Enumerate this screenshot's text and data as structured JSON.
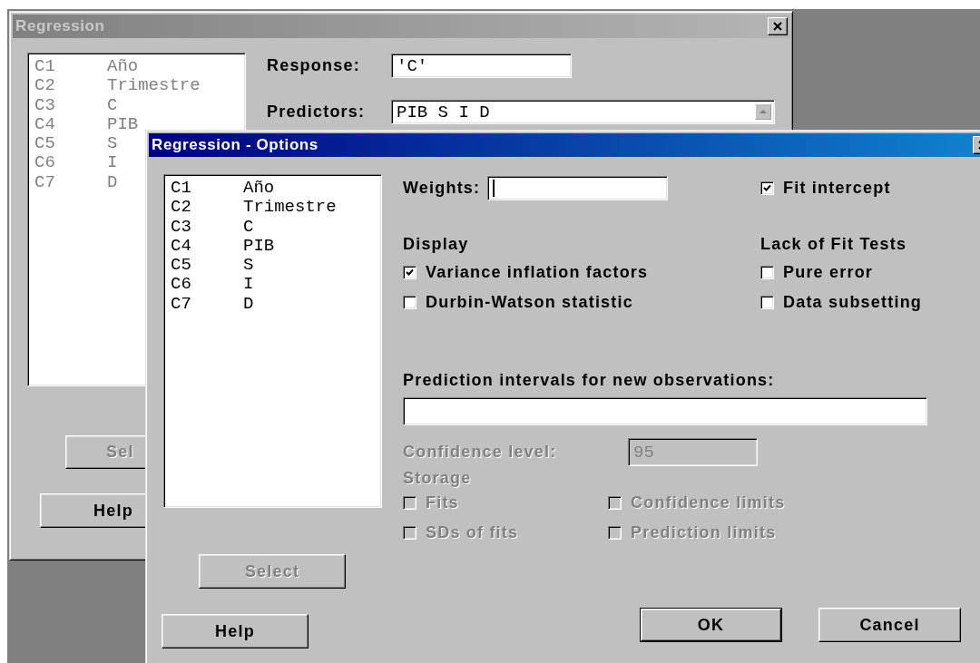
{
  "back_window": {
    "title": "Regression",
    "active": false,
    "columns": [
      {
        "id": "C1",
        "name": "Año"
      },
      {
        "id": "C2",
        "name": "Trimestre"
      },
      {
        "id": "C3",
        "name": "C"
      },
      {
        "id": "C4",
        "name": "PIB"
      },
      {
        "id": "C5",
        "name": "S"
      },
      {
        "id": "C6",
        "name": "I"
      },
      {
        "id": "C7",
        "name": "D"
      }
    ],
    "columns_disabled": true,
    "response": {
      "label": "Response:",
      "value": "'C'"
    },
    "predictors": {
      "label": "Predictors:",
      "value": "PIB S I D"
    },
    "buttons": [
      {
        "label": "Sel",
        "disabled": true
      },
      {
        "label": "Help",
        "disabled": false
      }
    ]
  },
  "options_window": {
    "title": "Regression - Options",
    "active": true,
    "columns": [
      {
        "id": "C1",
        "name": "Año"
      },
      {
        "id": "C2",
        "name": "Trimestre"
      },
      {
        "id": "C3",
        "name": "C"
      },
      {
        "id": "C4",
        "name": "PIB"
      },
      {
        "id": "C5",
        "name": "S"
      },
      {
        "id": "C6",
        "name": "I"
      },
      {
        "id": "C7",
        "name": "D"
      }
    ],
    "weights": {
      "label": "Weights:",
      "focused": true
    },
    "fit_intercept": {
      "label": "Fit intercept",
      "checked": true,
      "disabled": false
    },
    "display": {
      "heading": "Display",
      "options": [
        {
          "label": "Variance inflation factors",
          "checked": true,
          "disabled": false
        },
        {
          "label": "Durbin-Watson statistic",
          "checked": false,
          "disabled": false
        }
      ]
    },
    "lack_of_fit": {
      "heading": "Lack of Fit Tests",
      "options": [
        {
          "label": "Pure error",
          "checked": false,
          "disabled": false
        },
        {
          "label": "Data subsetting",
          "checked": false,
          "disabled": false
        }
      ]
    },
    "prediction_intervals": {
      "label": "Prediction intervals for new observations:"
    },
    "confidence_level": {
      "label": "Confidence level:",
      "value": "95",
      "disabled": true
    },
    "storage": {
      "heading": "Storage",
      "disabled": true,
      "options": [
        {
          "label": "Fits",
          "checked": false,
          "disabled": true
        },
        {
          "label": "Confidence limits",
          "checked": false,
          "disabled": true
        },
        {
          "label": "SDs of fits",
          "checked": false,
          "disabled": true
        },
        {
          "label": "Prediction limits",
          "checked": false,
          "disabled": true
        }
      ]
    },
    "select_button": {
      "label": "Select",
      "disabled": true,
      "default": false
    },
    "help_button": {
      "label": "Help",
      "disabled": false,
      "default": false
    },
    "buttons": [
      {
        "label": "OK",
        "disabled": false,
        "default": true
      },
      {
        "label": "Cancel",
        "disabled": false,
        "default": false
      }
    ]
  }
}
